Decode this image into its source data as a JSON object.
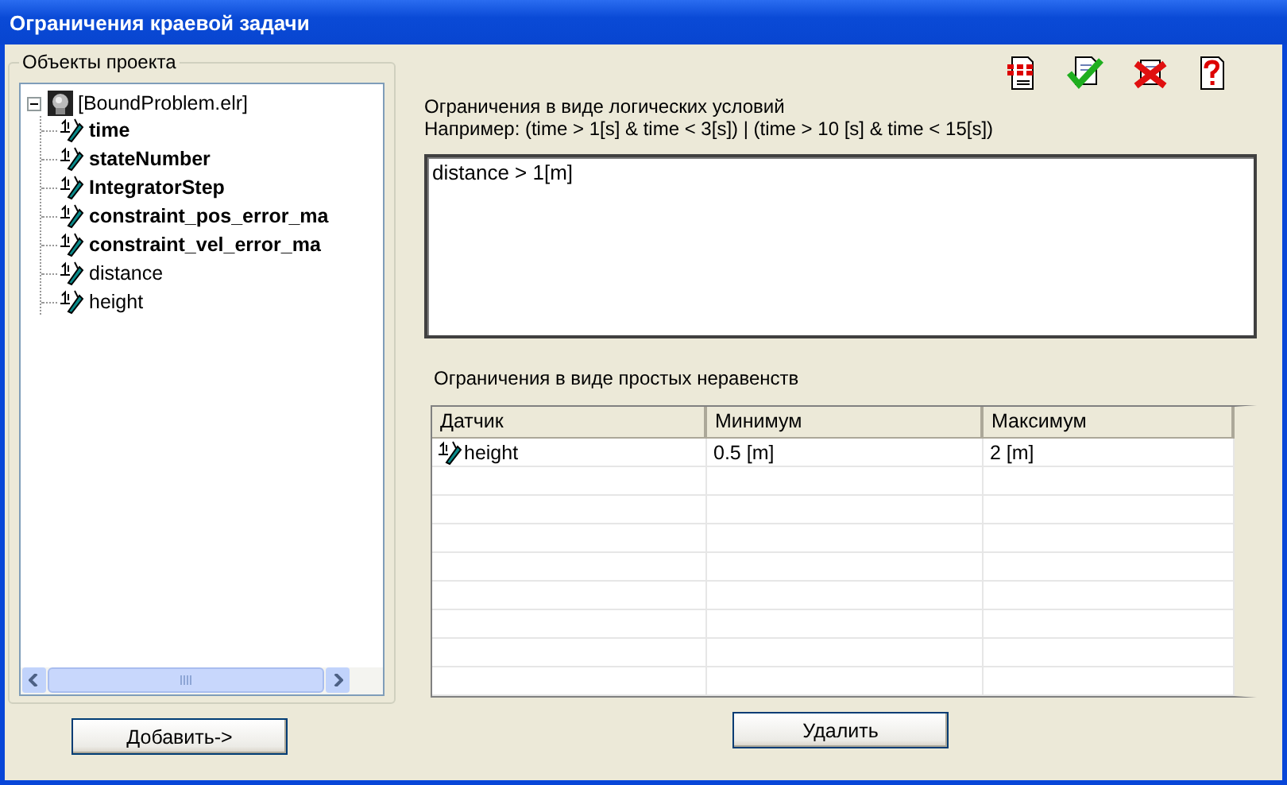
{
  "window": {
    "title": "Ограничения краевой задачи"
  },
  "project_objects": {
    "title": "Объекты проекта",
    "tree": [
      {
        "label": "[BoundProblem.elr]",
        "kind": "model",
        "expanded": true,
        "bold": false,
        "children": [
          {
            "label": "time",
            "kind": "sensor",
            "bold": true
          },
          {
            "label": "stateNumber",
            "kind": "sensor",
            "bold": true
          },
          {
            "label": "IntegratorStep",
            "kind": "sensor",
            "bold": true
          },
          {
            "label": "constraint_pos_error_ma",
            "kind": "sensor",
            "bold": true
          },
          {
            "label": "constraint_vel_error_ma",
            "kind": "sensor",
            "bold": true
          },
          {
            "label": "distance",
            "kind": "sensor",
            "bold": false
          },
          {
            "label": "height",
            "kind": "sensor",
            "bold": false
          }
        ]
      }
    ],
    "add_button": "Добавить->"
  },
  "toolbar": [
    {
      "kind": "document"
    },
    {
      "kind": "accept"
    },
    {
      "kind": "reject"
    },
    {
      "kind": "help"
    }
  ],
  "logical": {
    "label": "Ограничения в виде логических условий",
    "example": "Например: (time > 1[s] & time < 3[s]) | (time > 10 [s] & time < 15[s])",
    "value": "distance > 1[m]"
  },
  "inequalities": {
    "label": "Ограничения в виде простых неравенств",
    "columns": [
      "Датчик",
      "Минимум",
      "Максимум"
    ],
    "rows": [
      {
        "sensor": "height",
        "min": "0.5 [m]",
        "max": "2 [m]"
      }
    ],
    "delete_button": "Удалить"
  }
}
